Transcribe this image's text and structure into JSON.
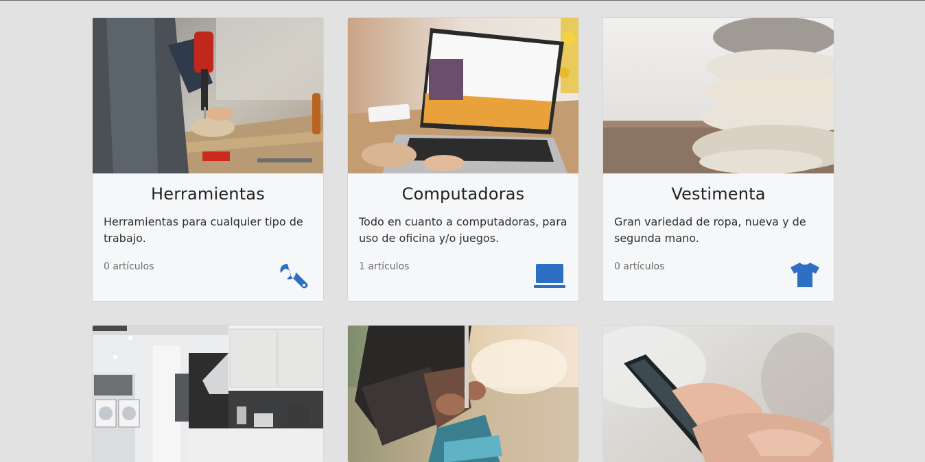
{
  "accent_color": "#2d6fc3",
  "categories": [
    {
      "title": "Herramientas",
      "description": "Herramientas para cualquier tipo de trabajo.",
      "count": "0 artículos",
      "icon": "wrench-icon"
    },
    {
      "title": "Computadoras",
      "description": "Todo en cuanto a computadoras, para uso de oficina y/o juegos.",
      "count": "1 artículos",
      "icon": "laptop-icon"
    },
    {
      "title": "Vestimenta",
      "description": "Gran variedad de ropa, nueva y de segunda mano.",
      "count": "0 artículos",
      "icon": "tshirt-icon"
    },
    {
      "image": "kitchen-appliances-photo"
    },
    {
      "image": "running-shoes-photo"
    },
    {
      "image": "smartphone-photo"
    }
  ]
}
